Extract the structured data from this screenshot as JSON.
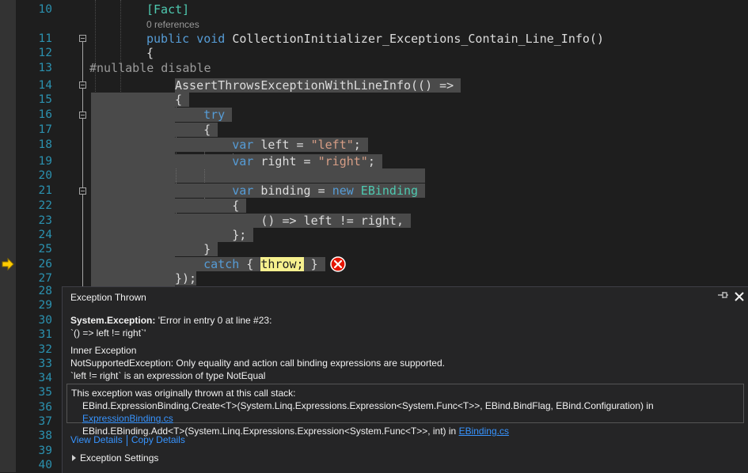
{
  "editor": {
    "line_numbers": [
      "10",
      "11",
      "12",
      "13",
      "14",
      "15",
      "16",
      "17",
      "18",
      "19",
      "20",
      "21",
      "22",
      "23",
      "24",
      "25",
      "26",
      "27",
      "28",
      "29",
      "30",
      "31",
      "32",
      "33",
      "34",
      "35",
      "36",
      "37",
      "38",
      "39",
      "40"
    ],
    "codelens": "0 references",
    "lines": {
      "l10_attr": "[Fact]",
      "l11_public": "public",
      "l11_void": "void",
      "l11_name": " CollectionInitializer_Exceptions_Contain_Line_Info()",
      "l12": "{",
      "l13": "#nullable disable",
      "l14": "AssertThrowsExceptionWithLineInfo(() =>",
      "l15": "{",
      "l16": "try",
      "l17": "{",
      "l18_var": "var",
      "l18_rest": " left = ",
      "l18_str": "\"left\"",
      "l18_end": ";",
      "l19_var": "var",
      "l19_rest": " right = ",
      "l19_str": "\"right\"",
      "l19_end": ";",
      "l21_var": "var",
      "l21_rest": " binding = ",
      "l21_new": "new",
      "l21_type": " EBinding",
      "l22": "{",
      "l23": "    () => left != right,",
      "l24": "};",
      "l25": "}",
      "l26_catch": "catch",
      "l26_open": " { ",
      "l26_throw": "throw;",
      "l26_close": " }",
      "l27": "});"
    }
  },
  "exception": {
    "title": "Exception Thrown",
    "type": "System.Exception:",
    "message_1": " 'Error in entry 0 at line #23:",
    "message_2": "`() => left != right`'",
    "inner_heading": "Inner Exception",
    "inner_1": "NotSupportedException: Only equality and action call binding expressions are supported.",
    "inner_2": "`left != right` is an expression of type NotEqual",
    "stack_heading": "This exception was originally thrown at this call stack:",
    "stack_1": "EBind.ExpressionBinding.Create<T>(System.Linq.Expressions.Expression<System.Func<T>>, EBind.BindFlag, EBind.Configuration) in ",
    "stack_1_link": "ExpressionBinding.cs",
    "stack_2": "EBind.EBinding.Add<T>(System.Linq.Expressions.Expression<System.Func<T>>, int) in ",
    "stack_2_link": "EBinding.cs",
    "view_details": "View Details",
    "copy_details": "Copy Details",
    "settings": "Exception Settings"
  },
  "colors": {
    "background": "#1e1e1e",
    "line_number": "#2b91af",
    "keyword": "#569cd6",
    "string": "#d69d85",
    "type": "#4ec9b0",
    "selection": "#4a4a4a",
    "link": "#3794ff",
    "error": "#e51400",
    "execution_arrow": "#ffcc00"
  },
  "icons": [
    "execution-pointer-icon",
    "error-icon",
    "pin-icon",
    "close-icon",
    "expand-triangle-icon",
    "collapse-icon"
  ]
}
